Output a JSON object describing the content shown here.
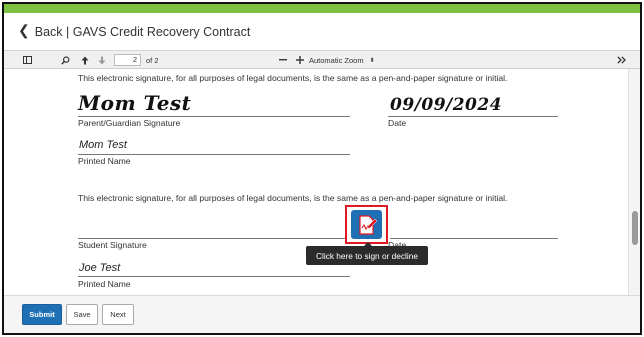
{
  "header": {
    "back_label": "Back",
    "title": "GAVS Credit Recovery Contract"
  },
  "toolbar": {
    "page_current": "2",
    "page_of": "of 2",
    "zoom": "Automatic Zoom"
  },
  "document": {
    "statement": "This electronic signature, for all purposes of legal documents, is the same as a pen-and-paper signature or initial.",
    "parent_signature": "Mom Test",
    "parent_signature_label": "Parent/Guardian Signature",
    "date_value": "09/09/2024",
    "date_label": "Date",
    "parent_printed_name": "Mom Test",
    "printed_name_label": "Printed Name",
    "student_signature_label": "Student Signature",
    "student_date_label": "Date",
    "student_printed_name": "Joe Test"
  },
  "sign_tooltip": "Click here to sign or decline",
  "footer": {
    "submit": "Submit",
    "save": "Save",
    "next": "Next"
  },
  "colors": {
    "accent_green": "#7dc242",
    "primary_blue": "#1f6fb5",
    "highlight_red": "#e01a22"
  }
}
